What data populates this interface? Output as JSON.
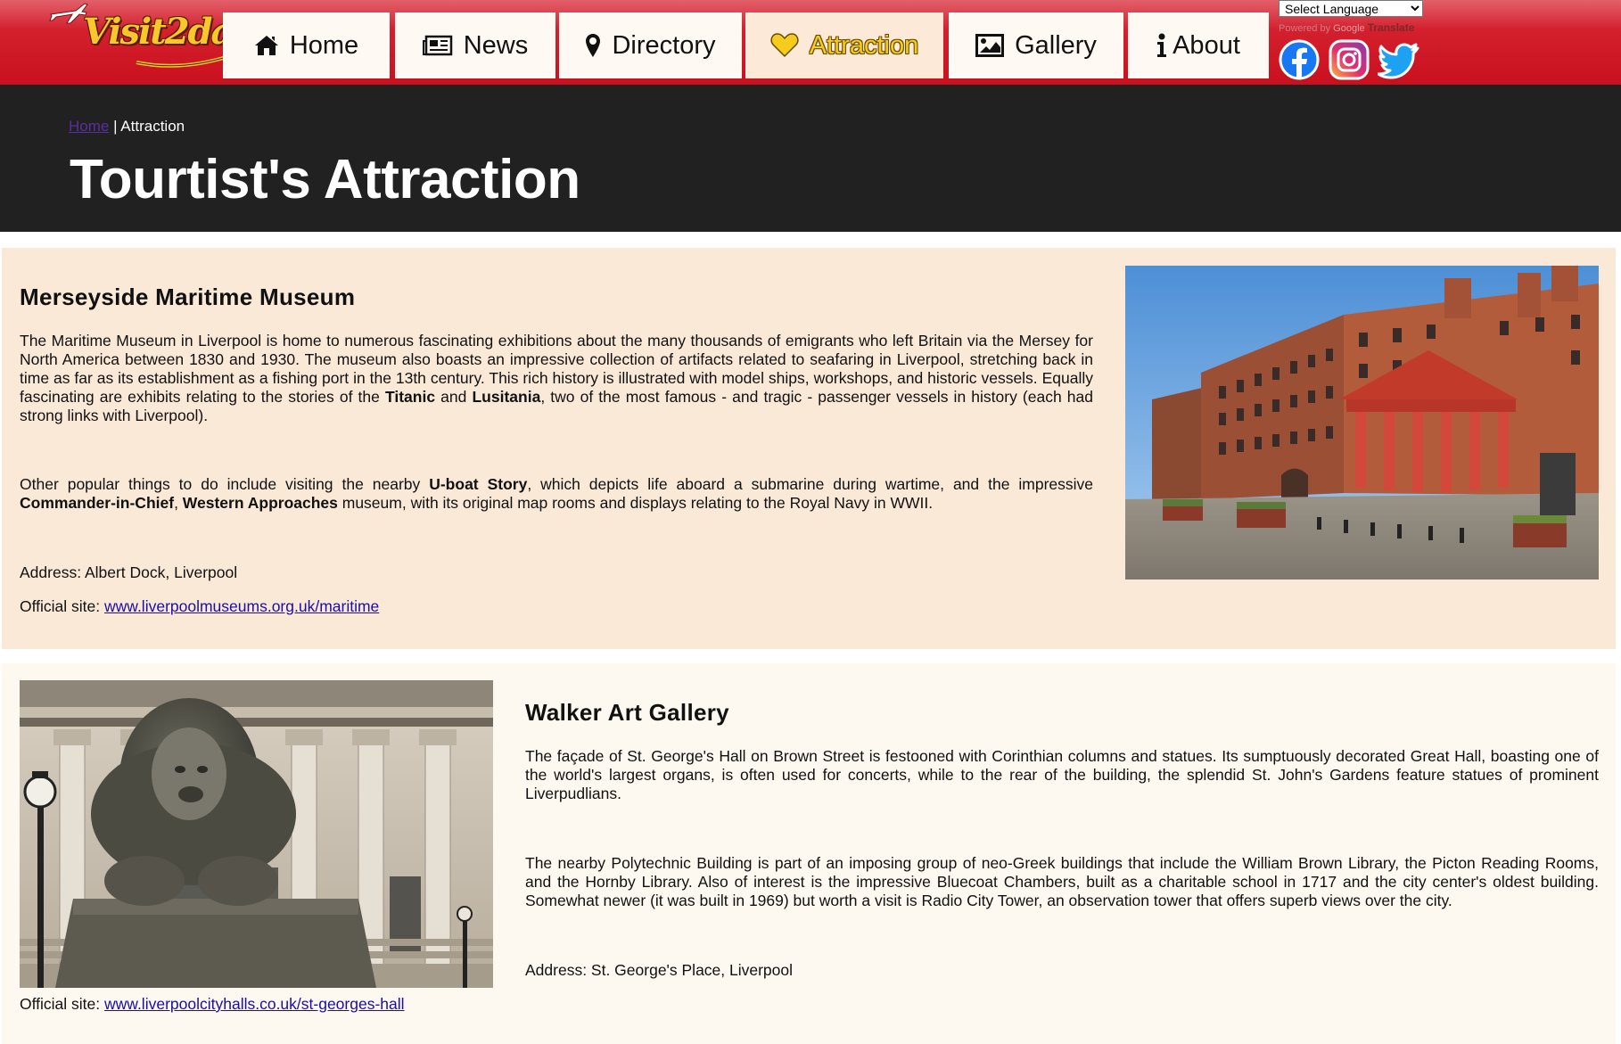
{
  "header": {
    "logo_text": "Visit2day",
    "nav": [
      {
        "label": "Home",
        "icon": "home-icon"
      },
      {
        "label": "News",
        "icon": "newspaper-icon"
      },
      {
        "label": "Directory",
        "icon": "map-marker-icon"
      },
      {
        "label": "Attraction",
        "icon": "heart-icon",
        "active": true
      },
      {
        "label": "Gallery",
        "icon": "image-icon"
      },
      {
        "label": "About",
        "icon": "info-icon"
      }
    ],
    "language_select": "Select Language",
    "powered_by": "Powered by",
    "google": "Google",
    "translate": "Translate",
    "social": [
      "facebook-icon",
      "instagram-icon",
      "twitter-icon"
    ]
  },
  "hero": {
    "breadcrumb_home": "Home",
    "breadcrumb_sep": " | ",
    "breadcrumb_current": "Attraction",
    "title": "Tourtist's Attraction"
  },
  "attractions": [
    {
      "title": "Merseyside Maritime Museum",
      "p1_a": "The Maritime Museum in Liverpool is home to numerous fascinating exhibitions about the many thousands of emigrants who left Britain via the Mersey for North America between 1830 and 1930. The museum also boasts an impressive collection of artifacts related to seafaring in Liverpool, stretching back in time as far as its establishment as a fishing port in the 13th century. This rich history is illustrated with model ships, workshops, and historic vessels. Equally fascinating are exhibits relating to the stories of the ",
      "p1_b1": "Titanic",
      "p1_c": " and ",
      "p1_b2": "Lusitania",
      "p1_d": ", two of the most famous - and tragic - passenger vessels in history (each had strong links with Liverpool).",
      "p2_a": "Other popular things to do include visiting the nearby ",
      "p2_b1": "U-boat Story",
      "p2_c": ", which depicts life aboard a submarine during wartime, and the impressive ",
      "p2_b2": "Commander-in-Chief",
      "p2_d": ", ",
      "p2_b3": "Western Approaches",
      "p2_e": " museum, with its original map rooms and displays relating to the Royal Navy in WWII.",
      "address": "Address: Albert Dock, Liverpool",
      "site_label": "Official site: ",
      "site_link": "www.liverpoolmuseums.org.uk/maritime"
    },
    {
      "title": "Walker Art Gallery",
      "p1": "The façade of St. George's Hall on Brown Street is festooned with Corinthian columns and statues. Its sumptuously decorated Great Hall, boasting one of the world's largest organs, is often used for concerts, while to the rear of the building, the splendid St. John's Gardens feature statues of prominent Liverpudlians.",
      "p2": "The nearby Polytechnic Building is part of an imposing group of neo-Greek buildings that include the William Brown Library, the Picton Reading Rooms, and the Hornby Library. Also of interest is the impressive Bluecoat Chambers, built as a charitable school in 1717 and the city center's oldest building. Somewhat newer (it was built in 1969) but worth a visit is Radio City Tower, an observation tower that offers superb views over the city.",
      "address": "Address: St. George's Place, Liverpool",
      "site_label": "Official site: ",
      "site_link": "www.liverpoolcityhalls.co.uk/st-georges-hall"
    }
  ]
}
